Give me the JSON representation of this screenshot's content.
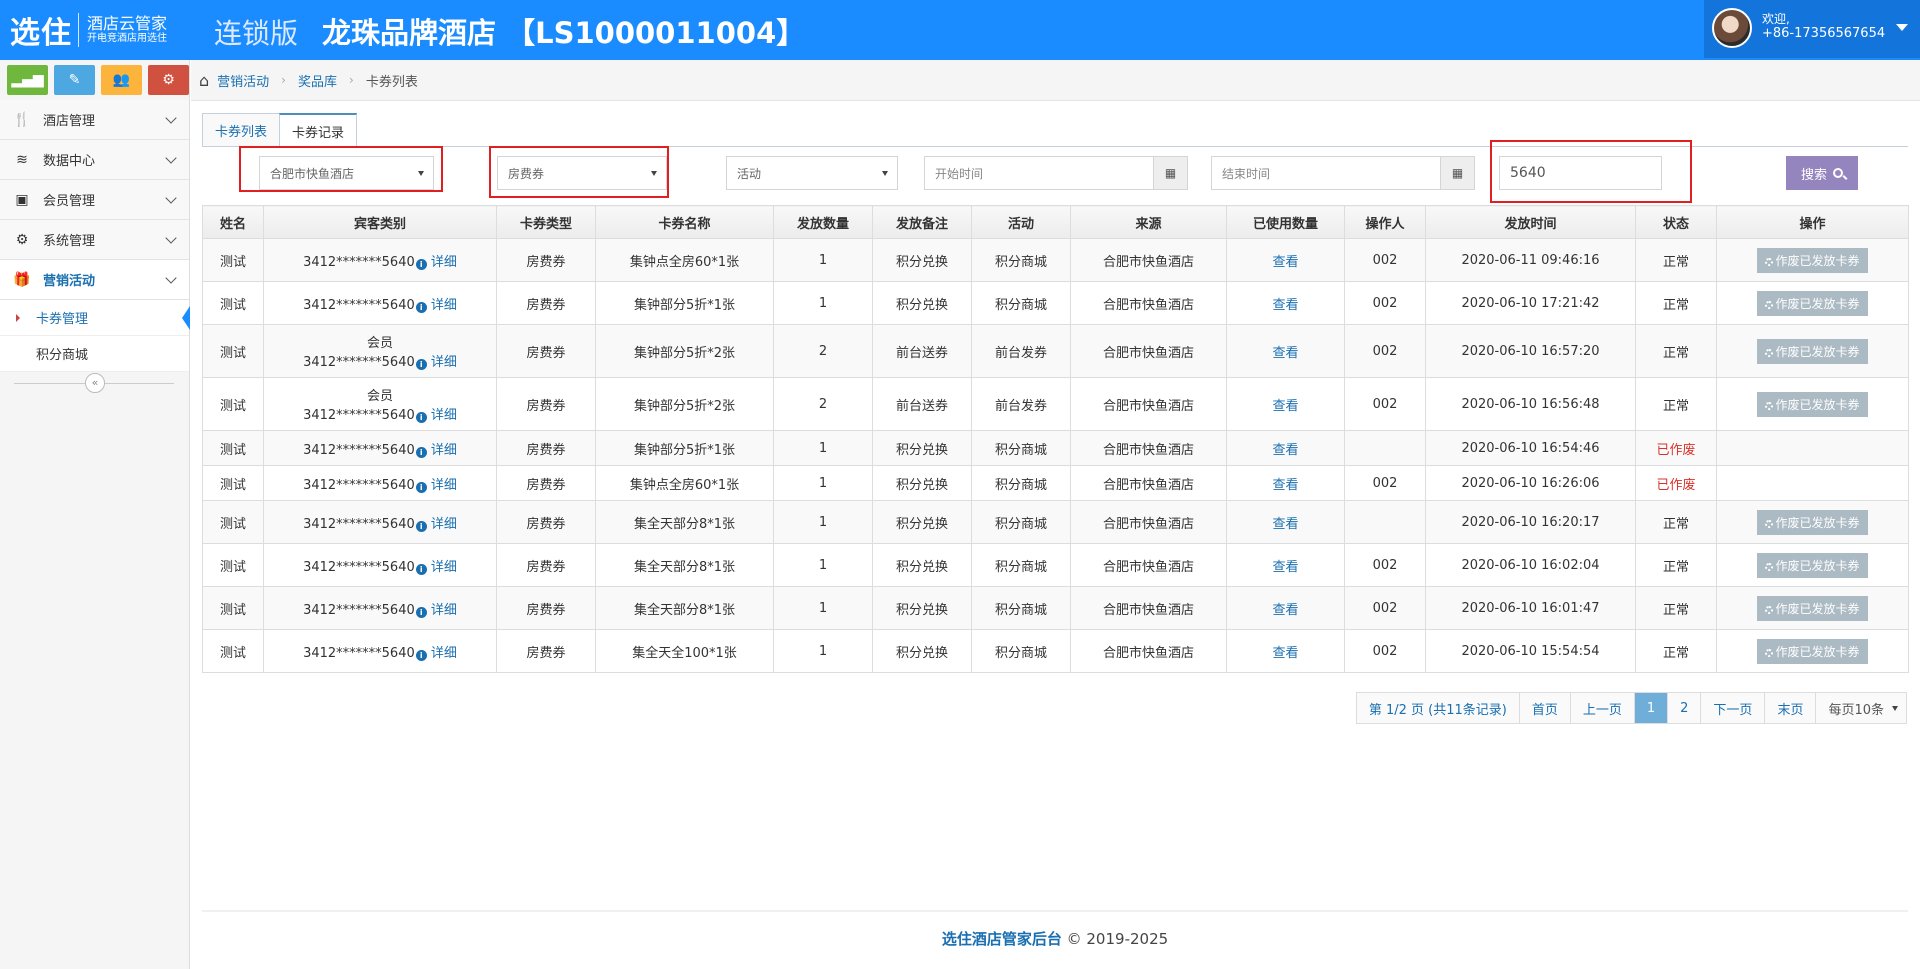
{
  "header": {
    "logo_main": "选住",
    "logo_sub1": "酒店云管家",
    "logo_sub2": "开电竞酒店用选住",
    "edition": "连锁版",
    "hotel_title": "龙珠品牌酒店 【LS1000011004】",
    "user_welcome": "欢迎,",
    "user_phone": "+86-17356567654"
  },
  "sidebar": {
    "menu": [
      {
        "label": "酒店管理",
        "icon": "fork-knife-icon"
      },
      {
        "label": "数据中心",
        "icon": "database-icon"
      },
      {
        "label": "会员管理",
        "icon": "money-icon"
      },
      {
        "label": "系统管理",
        "icon": "gear-icon"
      },
      {
        "label": "营销活动",
        "icon": "gift-icon"
      }
    ],
    "sub": [
      {
        "label": "卡券管理"
      },
      {
        "label": "积分商城"
      }
    ],
    "collapse_glyph": "«"
  },
  "breadcrumb": {
    "items": [
      "营销活动",
      "奖品库",
      "卡券列表"
    ]
  },
  "tabs": [
    "卡券列表",
    "卡券记录"
  ],
  "filters": {
    "hotel": "合肥市快鱼酒店",
    "coupon_type": "房费券",
    "activity": "活动",
    "start_placeholder": "开始时间",
    "end_placeholder": "结束时间",
    "search_value": "5640",
    "search_button": "搜索"
  },
  "table": {
    "headers": [
      "姓名",
      "宾客类别",
      "卡券类型",
      "卡券名称",
      "发放数量",
      "发放备注",
      "活动",
      "来源",
      "已使用数量",
      "操作人",
      "发放时间",
      "状态",
      "操作"
    ],
    "rows": [
      {
        "name": "测试",
        "guest_line1": "",
        "guest": "3412*******5640",
        "detail": "详细",
        "type": "房费券",
        "coupon": "集钟点全房60*1张",
        "qty": "1",
        "remark": "积分兑换",
        "activity": "积分商城",
        "source": "合肥市快鱼酒店",
        "used": "查看",
        "operator": "002",
        "time": "2020-06-11 09:46:16",
        "status": "正常",
        "op": "作废已发放卡券"
      },
      {
        "name": "测试",
        "guest_line1": "",
        "guest": "3412*******5640",
        "detail": "详细",
        "type": "房费券",
        "coupon": "集钟部分5折*1张",
        "qty": "1",
        "remark": "积分兑换",
        "activity": "积分商城",
        "source": "合肥市快鱼酒店",
        "used": "查看",
        "operator": "002",
        "time": "2020-06-10 17:21:42",
        "status": "正常",
        "op": "作废已发放卡券"
      },
      {
        "name": "测试",
        "guest_line1": "会员",
        "guest": "3412*******5640",
        "detail": "详细",
        "type": "房费券",
        "coupon": "集钟部分5折*2张",
        "qty": "2",
        "remark": "前台送券",
        "activity": "前台发券",
        "source": "合肥市快鱼酒店",
        "used": "查看",
        "operator": "002",
        "time": "2020-06-10 16:57:20",
        "status": "正常",
        "op": "作废已发放卡券"
      },
      {
        "name": "测试",
        "guest_line1": "会员",
        "guest": "3412*******5640",
        "detail": "详细",
        "type": "房费券",
        "coupon": "集钟部分5折*2张",
        "qty": "2",
        "remark": "前台送券",
        "activity": "前台发券",
        "source": "合肥市快鱼酒店",
        "used": "查看",
        "operator": "002",
        "time": "2020-06-10 16:56:48",
        "status": "正常",
        "op": "作废已发放卡券"
      },
      {
        "name": "测试",
        "guest_line1": "",
        "guest": "3412*******5640",
        "detail": "详细",
        "type": "房费券",
        "coupon": "集钟部分5折*1张",
        "qty": "1",
        "remark": "积分兑换",
        "activity": "积分商城",
        "source": "合肥市快鱼酒店",
        "used": "查看",
        "operator": "",
        "time": "2020-06-10 16:54:46",
        "status": "已作废",
        "op": ""
      },
      {
        "name": "测试",
        "guest_line1": "",
        "guest": "3412*******5640",
        "detail": "详细",
        "type": "房费券",
        "coupon": "集钟点全房60*1张",
        "qty": "1",
        "remark": "积分兑换",
        "activity": "积分商城",
        "source": "合肥市快鱼酒店",
        "used": "查看",
        "operator": "002",
        "time": "2020-06-10 16:26:06",
        "status": "已作废",
        "op": ""
      },
      {
        "name": "测试",
        "guest_line1": "",
        "guest": "3412*******5640",
        "detail": "详细",
        "type": "房费券",
        "coupon": "集全天部分8*1张",
        "qty": "1",
        "remark": "积分兑换",
        "activity": "积分商城",
        "source": "合肥市快鱼酒店",
        "used": "查看",
        "operator": "",
        "time": "2020-06-10 16:20:17",
        "status": "正常",
        "op": "作废已发放卡券"
      },
      {
        "name": "测试",
        "guest_line1": "",
        "guest": "3412*******5640",
        "detail": "详细",
        "type": "房费券",
        "coupon": "集全天部分8*1张",
        "qty": "1",
        "remark": "积分兑换",
        "activity": "积分商城",
        "source": "合肥市快鱼酒店",
        "used": "查看",
        "operator": "002",
        "time": "2020-06-10 16:02:04",
        "status": "正常",
        "op": "作废已发放卡券"
      },
      {
        "name": "测试",
        "guest_line1": "",
        "guest": "3412*******5640",
        "detail": "详细",
        "type": "房费券",
        "coupon": "集全天部分8*1张",
        "qty": "1",
        "remark": "积分兑换",
        "activity": "积分商城",
        "source": "合肥市快鱼酒店",
        "used": "查看",
        "operator": "002",
        "time": "2020-06-10 16:01:47",
        "status": "正常",
        "op": "作废已发放卡券"
      },
      {
        "name": "测试",
        "guest_line1": "",
        "guest": "3412*******5640",
        "detail": "详细",
        "type": "房费券",
        "coupon": "集全天全100*1张",
        "qty": "1",
        "remark": "积分兑换",
        "activity": "积分商城",
        "source": "合肥市快鱼酒店",
        "used": "查看",
        "operator": "002",
        "time": "2020-06-10 15:54:54",
        "status": "正常",
        "op": "作废已发放卡券"
      }
    ]
  },
  "pager": {
    "info": "第 1/2 页 (共11条记录)",
    "first": "首页",
    "prev": "上一页",
    "page1": "1",
    "page2": "2",
    "next": "下一页",
    "last": "末页",
    "per_page": "每页10条"
  },
  "footer": {
    "brand": "选住酒店管家后台",
    "copy": "© 2019-2025"
  },
  "colors": {
    "header_bg": "#1a8cff",
    "link": "#1a6fb0",
    "void_status": "#d9322a",
    "search_button": "#9585bf",
    "highlight": "#e02020"
  }
}
